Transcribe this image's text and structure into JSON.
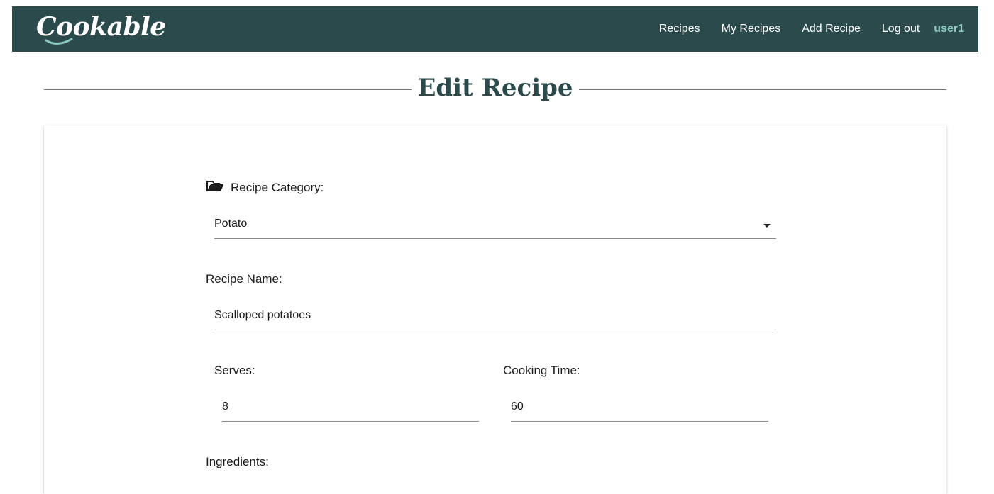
{
  "nav": {
    "brand": "Cookable",
    "links": [
      "Recipes",
      "My Recipes",
      "Add Recipe",
      "Log out"
    ],
    "username": "user1"
  },
  "page": {
    "title": "Edit Recipe"
  },
  "form": {
    "category": {
      "label": "Recipe Category:",
      "icon": "folder-open-icon",
      "value": "Potato"
    },
    "name": {
      "label": "Recipe Name:",
      "value": "Scalloped potatoes"
    },
    "serves": {
      "label": "Serves:",
      "value": "8"
    },
    "cooking_time": {
      "label": "Cooking Time:",
      "value": "60"
    },
    "ingredients": {
      "label": "Ingredients:"
    }
  },
  "colors": {
    "navbar_bg": "#2b4a4b",
    "title": "#2b4a4b",
    "username": "#8cc8c4"
  }
}
